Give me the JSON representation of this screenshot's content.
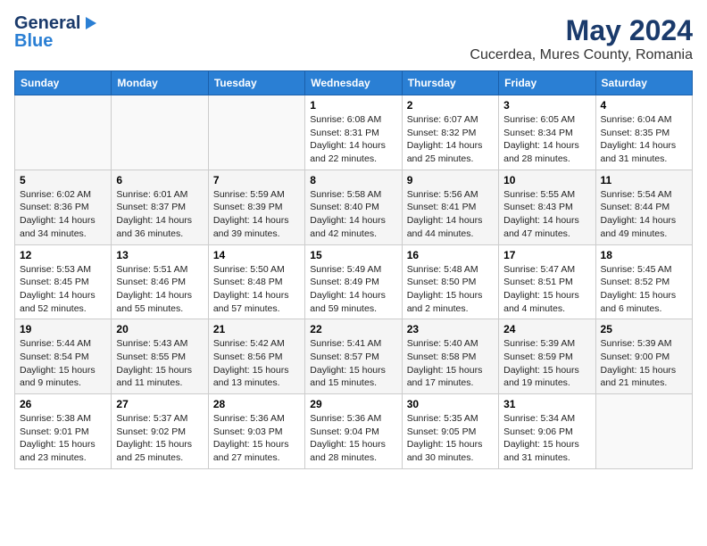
{
  "header": {
    "logo_general": "General",
    "logo_blue": "Blue",
    "main_title": "May 2024",
    "subtitle": "Cucerdea, Mures County, Romania"
  },
  "weekdays": [
    "Sunday",
    "Monday",
    "Tuesday",
    "Wednesday",
    "Thursday",
    "Friday",
    "Saturday"
  ],
  "weeks": [
    [
      {
        "day": "",
        "info": ""
      },
      {
        "day": "",
        "info": ""
      },
      {
        "day": "",
        "info": ""
      },
      {
        "day": "1",
        "info": "Sunrise: 6:08 AM\nSunset: 8:31 PM\nDaylight: 14 hours\nand 22 minutes."
      },
      {
        "day": "2",
        "info": "Sunrise: 6:07 AM\nSunset: 8:32 PM\nDaylight: 14 hours\nand 25 minutes."
      },
      {
        "day": "3",
        "info": "Sunrise: 6:05 AM\nSunset: 8:34 PM\nDaylight: 14 hours\nand 28 minutes."
      },
      {
        "day": "4",
        "info": "Sunrise: 6:04 AM\nSunset: 8:35 PM\nDaylight: 14 hours\nand 31 minutes."
      }
    ],
    [
      {
        "day": "5",
        "info": "Sunrise: 6:02 AM\nSunset: 8:36 PM\nDaylight: 14 hours\nand 34 minutes."
      },
      {
        "day": "6",
        "info": "Sunrise: 6:01 AM\nSunset: 8:37 PM\nDaylight: 14 hours\nand 36 minutes."
      },
      {
        "day": "7",
        "info": "Sunrise: 5:59 AM\nSunset: 8:39 PM\nDaylight: 14 hours\nand 39 minutes."
      },
      {
        "day": "8",
        "info": "Sunrise: 5:58 AM\nSunset: 8:40 PM\nDaylight: 14 hours\nand 42 minutes."
      },
      {
        "day": "9",
        "info": "Sunrise: 5:56 AM\nSunset: 8:41 PM\nDaylight: 14 hours\nand 44 minutes."
      },
      {
        "day": "10",
        "info": "Sunrise: 5:55 AM\nSunset: 8:43 PM\nDaylight: 14 hours\nand 47 minutes."
      },
      {
        "day": "11",
        "info": "Sunrise: 5:54 AM\nSunset: 8:44 PM\nDaylight: 14 hours\nand 49 minutes."
      }
    ],
    [
      {
        "day": "12",
        "info": "Sunrise: 5:53 AM\nSunset: 8:45 PM\nDaylight: 14 hours\nand 52 minutes."
      },
      {
        "day": "13",
        "info": "Sunrise: 5:51 AM\nSunset: 8:46 PM\nDaylight: 14 hours\nand 55 minutes."
      },
      {
        "day": "14",
        "info": "Sunrise: 5:50 AM\nSunset: 8:48 PM\nDaylight: 14 hours\nand 57 minutes."
      },
      {
        "day": "15",
        "info": "Sunrise: 5:49 AM\nSunset: 8:49 PM\nDaylight: 14 hours\nand 59 minutes."
      },
      {
        "day": "16",
        "info": "Sunrise: 5:48 AM\nSunset: 8:50 PM\nDaylight: 15 hours\nand 2 minutes."
      },
      {
        "day": "17",
        "info": "Sunrise: 5:47 AM\nSunset: 8:51 PM\nDaylight: 15 hours\nand 4 minutes."
      },
      {
        "day": "18",
        "info": "Sunrise: 5:45 AM\nSunset: 8:52 PM\nDaylight: 15 hours\nand 6 minutes."
      }
    ],
    [
      {
        "day": "19",
        "info": "Sunrise: 5:44 AM\nSunset: 8:54 PM\nDaylight: 15 hours\nand 9 minutes."
      },
      {
        "day": "20",
        "info": "Sunrise: 5:43 AM\nSunset: 8:55 PM\nDaylight: 15 hours\nand 11 minutes."
      },
      {
        "day": "21",
        "info": "Sunrise: 5:42 AM\nSunset: 8:56 PM\nDaylight: 15 hours\nand 13 minutes."
      },
      {
        "day": "22",
        "info": "Sunrise: 5:41 AM\nSunset: 8:57 PM\nDaylight: 15 hours\nand 15 minutes."
      },
      {
        "day": "23",
        "info": "Sunrise: 5:40 AM\nSunset: 8:58 PM\nDaylight: 15 hours\nand 17 minutes."
      },
      {
        "day": "24",
        "info": "Sunrise: 5:39 AM\nSunset: 8:59 PM\nDaylight: 15 hours\nand 19 minutes."
      },
      {
        "day": "25",
        "info": "Sunrise: 5:39 AM\nSunset: 9:00 PM\nDaylight: 15 hours\nand 21 minutes."
      }
    ],
    [
      {
        "day": "26",
        "info": "Sunrise: 5:38 AM\nSunset: 9:01 PM\nDaylight: 15 hours\nand 23 minutes."
      },
      {
        "day": "27",
        "info": "Sunrise: 5:37 AM\nSunset: 9:02 PM\nDaylight: 15 hours\nand 25 minutes."
      },
      {
        "day": "28",
        "info": "Sunrise: 5:36 AM\nSunset: 9:03 PM\nDaylight: 15 hours\nand 27 minutes."
      },
      {
        "day": "29",
        "info": "Sunrise: 5:36 AM\nSunset: 9:04 PM\nDaylight: 15 hours\nand 28 minutes."
      },
      {
        "day": "30",
        "info": "Sunrise: 5:35 AM\nSunset: 9:05 PM\nDaylight: 15 hours\nand 30 minutes."
      },
      {
        "day": "31",
        "info": "Sunrise: 5:34 AM\nSunset: 9:06 PM\nDaylight: 15 hours\nand 31 minutes."
      },
      {
        "day": "",
        "info": ""
      }
    ]
  ]
}
